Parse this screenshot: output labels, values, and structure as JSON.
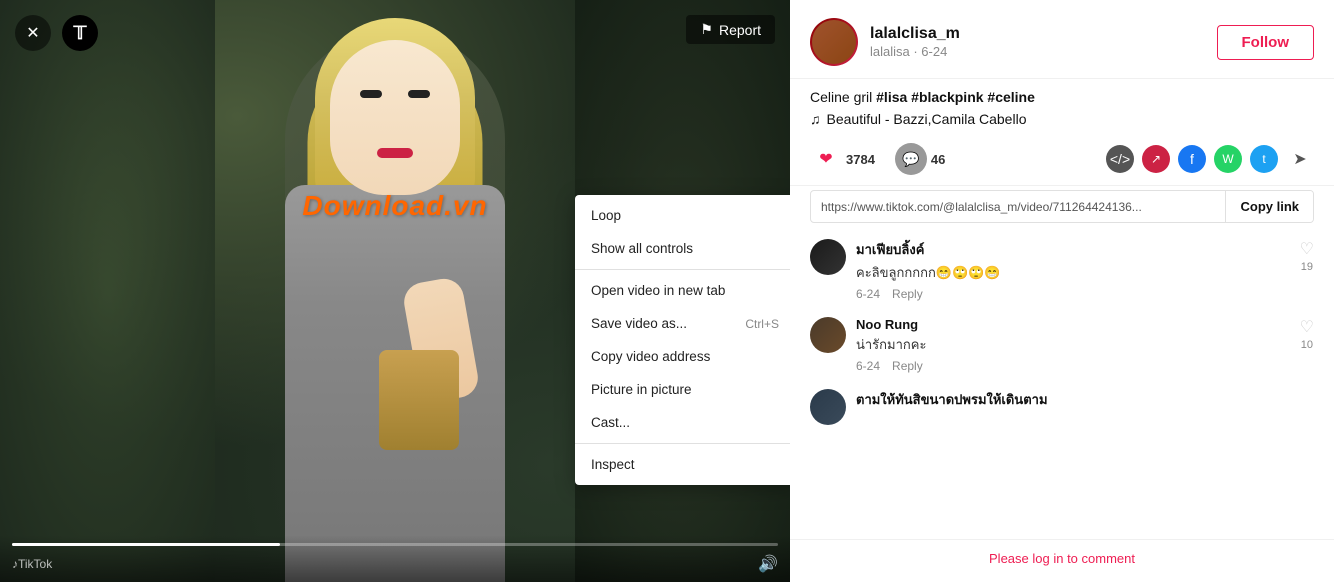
{
  "app": {
    "title": "TikTok"
  },
  "video_panel": {
    "report_label": "Report",
    "watermark": "♪TikTok",
    "download_overlay": "Download.vn"
  },
  "context_menu": {
    "items": [
      {
        "id": "loop",
        "label": "Loop",
        "shortcut": ""
      },
      {
        "id": "show-controls",
        "label": "Show all controls",
        "shortcut": ""
      },
      {
        "id": "separator-1",
        "type": "separator"
      },
      {
        "id": "open-tab",
        "label": "Open video in new tab",
        "shortcut": ""
      },
      {
        "id": "save-video",
        "label": "Save video as...",
        "shortcut": "Ctrl+S"
      },
      {
        "id": "copy-address",
        "label": "Copy video address",
        "shortcut": ""
      },
      {
        "id": "picture-in-picture",
        "label": "Picture in picture",
        "shortcut": ""
      },
      {
        "id": "cast",
        "label": "Cast...",
        "shortcut": ""
      },
      {
        "id": "separator-2",
        "type": "separator"
      },
      {
        "id": "inspect",
        "label": "Inspect",
        "shortcut": ""
      }
    ]
  },
  "right_panel": {
    "user": {
      "name": "lalalclisa_m",
      "sub": "lalalisa · 6-24"
    },
    "follow_label": "Follow",
    "description": {
      "text": "Celine gril ",
      "hashtags": "#lisa #blackpink #celine"
    },
    "music": {
      "note": "♫",
      "song": "Beautiful - Bazzi,Camila Cabello"
    },
    "actions": {
      "likes": "3784",
      "comments": "46"
    },
    "share_icons": [
      "</>",
      "↗",
      "f",
      "W",
      "t",
      "➤"
    ],
    "link": {
      "url": "https://www.tiktok.com/@lalalclisa_m/video/711264424136...",
      "copy_label": "Copy link"
    },
    "comments": [
      {
        "id": 1,
        "username": "มาเฟียบลิ้งค์",
        "text": "คะลิขลูกกกกก😁🙄🙄😁",
        "date": "6-24",
        "reply_label": "Reply",
        "likes": 19,
        "avatar_class": "comment-avatar-1"
      },
      {
        "id": 2,
        "username": "Noo Rung",
        "text": "น่ารักมากคะ",
        "date": "6-24",
        "reply_label": "Reply",
        "likes": 10,
        "avatar_class": "comment-avatar-2"
      },
      {
        "id": 3,
        "username": "ตามให้ทันสิขนาดปพรมให้เดินตาม",
        "text": "",
        "date": "",
        "reply_label": "",
        "likes": 0,
        "avatar_class": "comment-avatar-3"
      }
    ],
    "login_prompt": "Please log in to comment"
  }
}
